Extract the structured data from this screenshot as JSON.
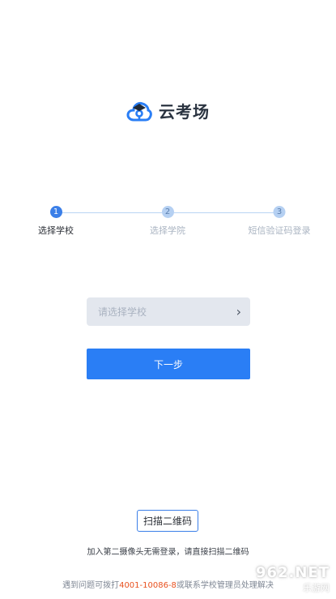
{
  "app": {
    "name": "云考场"
  },
  "stepper": {
    "steps": [
      {
        "number": "1",
        "label": "选择学校"
      },
      {
        "number": "2",
        "label": "选择学院"
      },
      {
        "number": "3",
        "label": "短信验证码登录"
      }
    ]
  },
  "school_select": {
    "placeholder": "请选择学校"
  },
  "next_button": {
    "label": "下一步"
  },
  "scan": {
    "label": "扫描二维码",
    "hint": "加入第二摄像头无需登录，请直接扫描二维码"
  },
  "footer": {
    "prefix": "遇到问题可拨打",
    "phone": "4001-10086-8",
    "suffix": "或联系学校管理员处理解决"
  },
  "watermark": {
    "top": "962.NET",
    "bottom": "乐游网"
  },
  "colors": {
    "accent": "#2a7ef5",
    "phone": "#e8501e"
  }
}
